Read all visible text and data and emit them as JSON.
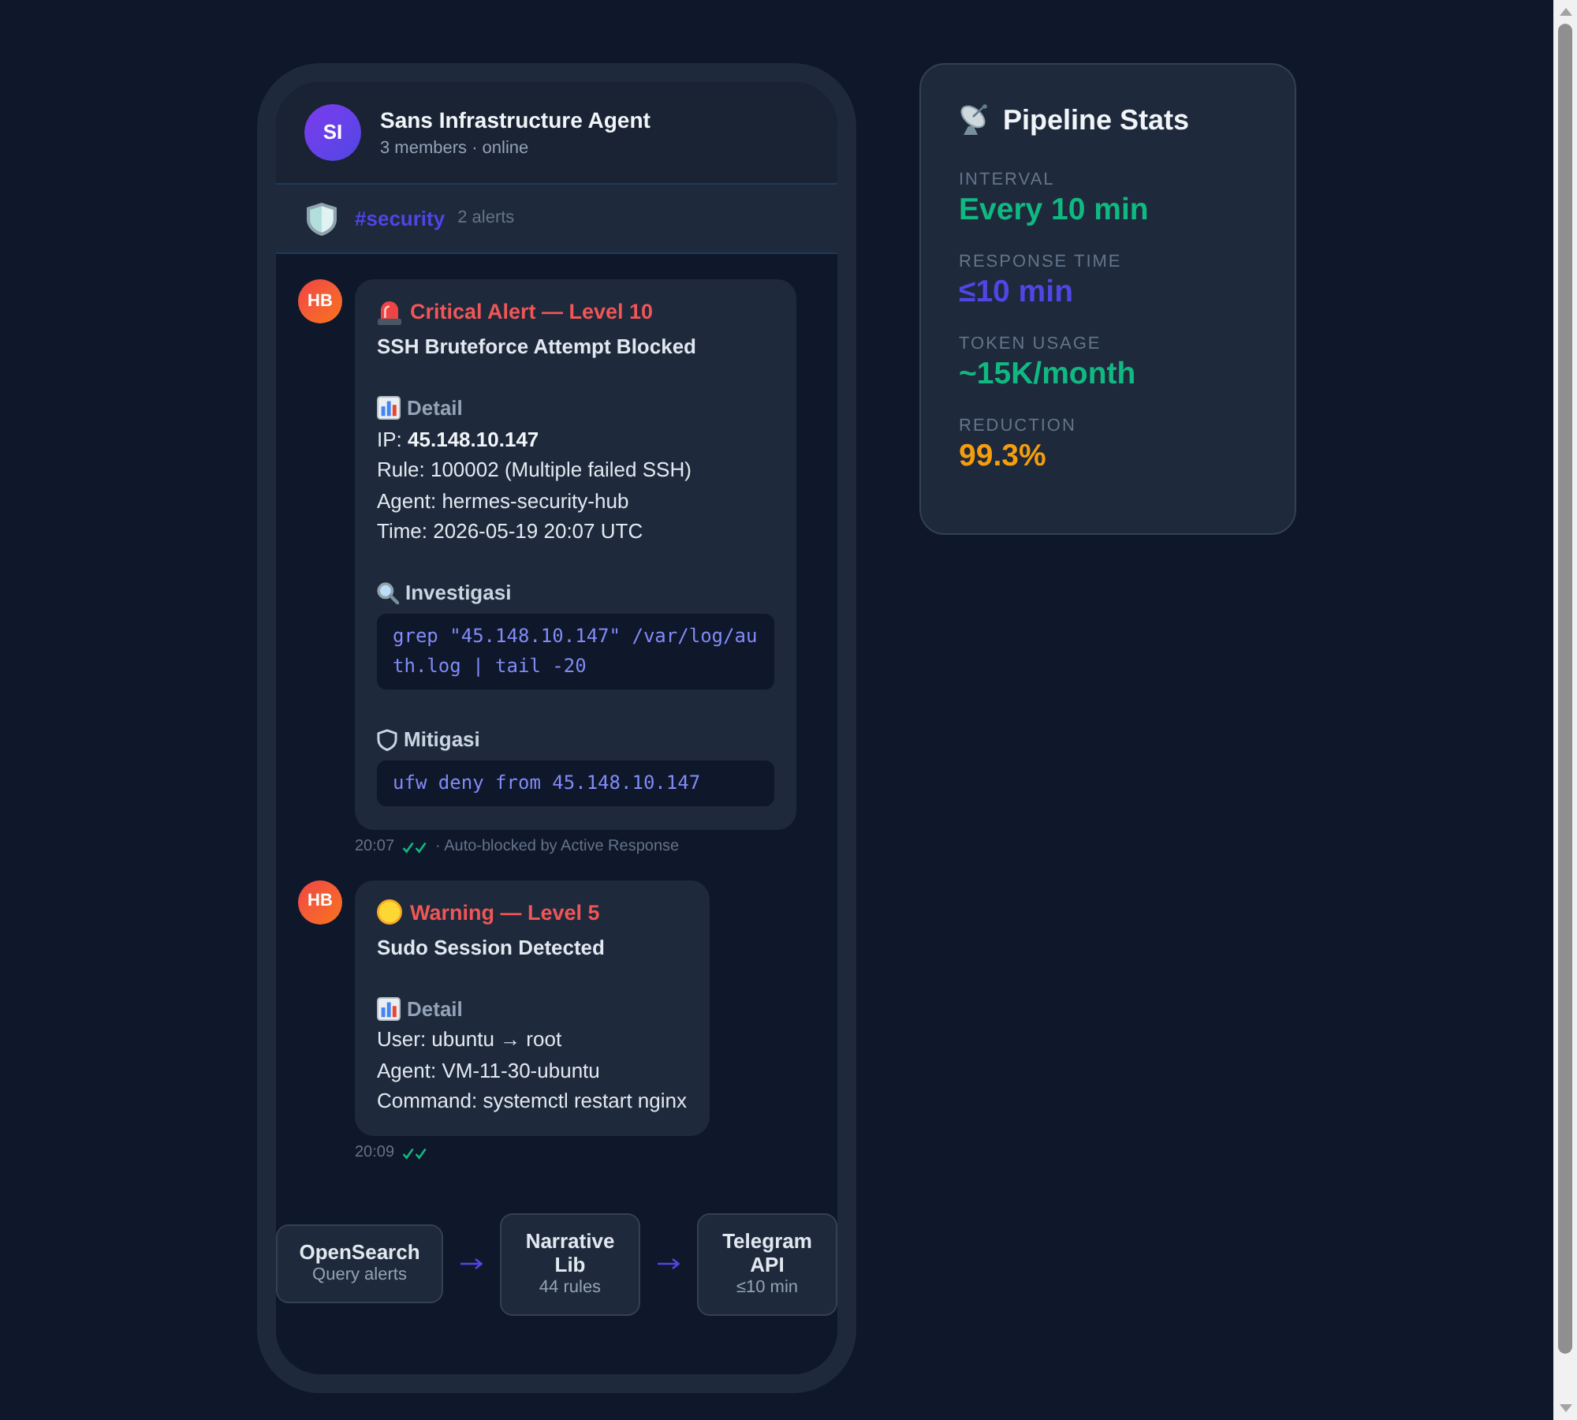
{
  "phone": {
    "header": {
      "avatar": "SI",
      "name": "Sans Infrastructure Agent",
      "status": "3 members · online"
    },
    "channel": {
      "name": "#security",
      "count": "2 alerts"
    },
    "messages": [
      {
        "avatar": "HB",
        "kind": "critical",
        "title": "Critical Alert — Level 10",
        "subtitle": "SSH Bruteforce Attempt Blocked",
        "sections": [
          {
            "kind": "detail",
            "heading": "Detail",
            "lines": [
              "IP: **45.148.10.147**",
              "Rule: 100002 (Multiple failed SSH)",
              "Agent: hermes-security-hub",
              "Time: 2026-05-19 20:07 UTC"
            ]
          },
          {
            "kind": "investigation",
            "heading": "Investigasi",
            "code": "grep \"45.148.10.147\" /var/log/auth.log | tail -20"
          },
          {
            "kind": "mitigation",
            "heading": "Mitigasi",
            "code": "ufw deny from 45.148.10.147"
          }
        ],
        "time": "20:07",
        "read": true,
        "note": "· Auto-blocked by Active Response"
      },
      {
        "avatar": "HB",
        "kind": "warning",
        "title": "Warning — Level 5",
        "subtitle": "Sudo Session Detected",
        "sections": [
          {
            "kind": "detail",
            "heading": "Detail",
            "lines": [
              "User: ubuntu → root",
              "Agent: VM-11-30-ubuntu",
              "Command: systemctl restart nginx"
            ]
          }
        ],
        "time": "20:09",
        "read": true
      }
    ],
    "pipeline": [
      {
        "name": "OpenSearch",
        "detail": "Query alerts"
      },
      {
        "name": "Narrative Lib",
        "detail": "44 rules"
      },
      {
        "name": "Telegram API",
        "detail": "≤10 min"
      }
    ]
  },
  "stats": {
    "title": "Pipeline Stats",
    "items": [
      {
        "label": "INTERVAL",
        "value": "Every 10 min",
        "color": "#10b981"
      },
      {
        "label": "RESPONSE TIME",
        "value": "≤10 min",
        "color": "#4f46e5"
      },
      {
        "label": "TOKEN USAGE",
        "value": "~15K/month",
        "color": "#10b981"
      },
      {
        "label": "REDUCTION",
        "value": "99.3%",
        "color": "#f59e0b"
      }
    ]
  }
}
